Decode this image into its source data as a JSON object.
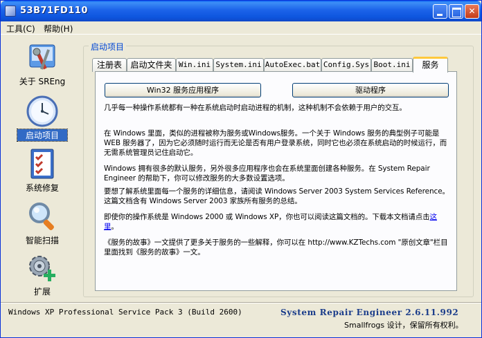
{
  "window": {
    "title": "53B71FD110"
  },
  "menu": {
    "tools": "工具(C)",
    "help": "帮助(H)"
  },
  "nav": [
    {
      "label": "关于 SREng",
      "icon": "tools-icon"
    },
    {
      "label": "启动项目",
      "icon": "clock-icon",
      "active": true
    },
    {
      "label": "系统修复",
      "icon": "checklist-icon"
    },
    {
      "label": "智能扫描",
      "icon": "magnifier-icon"
    },
    {
      "label": "扩展",
      "icon": "gear-plus-icon"
    }
  ],
  "group": {
    "title": "启动项目"
  },
  "tabs": [
    "注册表",
    "启动文件夹",
    "Win.ini",
    "System.ini",
    "AutoExec.bat",
    "Config.Sys",
    "Boot.ini",
    "服务"
  ],
  "buttons": {
    "win32": "Win32 服务应用程序",
    "driver": "驱动程序"
  },
  "paragraphs": {
    "p1": "几乎每一种操作系统都有一种在系统启动时启动进程的机制，这种机制不会依赖于用户的交互。",
    "p2": "在 Windows 里面，类似的进程被称为服务或Windows服务。一个关于 Windows 服务的典型例子可能是 WEB 服务器了，因为它必须随时运行而无论是否有用户登录系统，同时它也必须在系统启动的时候运行，而无需系统管理员记住启动它。",
    "p3": "Windows 拥有很多的默认服务，另外很多应用程序也会在系统里面创建各种服务。在 System Repair Engineer 的帮助下，你可以修改服务的大多数设置选项。",
    "p4": "要想了解系统里面每一个服务的详细信息，请阅读 Windows Server 2003 System Services Reference。这篇文档含有 Windows Server 2003 家族所有服务的总结。",
    "p5a": "即使你的操作系统是 Windows 2000 或 Windows XP，你也可以阅读这篇文档的。下载本文档请点击",
    "p5link": "这里",
    "p5b": "。",
    "p6": "《服务的故事》一文提供了更多关于服务的一些解释，你可以在 http://www.KZTechs.com \"原创文章\"栏目里面找到《服务的故事》一文。"
  },
  "status": {
    "os": "Windows XP Professional Service Pack 3 (Build 2600)",
    "app": "System Repair Engineer 2.6.11.992",
    "copyright": "Smallfrogs 设计，保留所有权利。"
  }
}
